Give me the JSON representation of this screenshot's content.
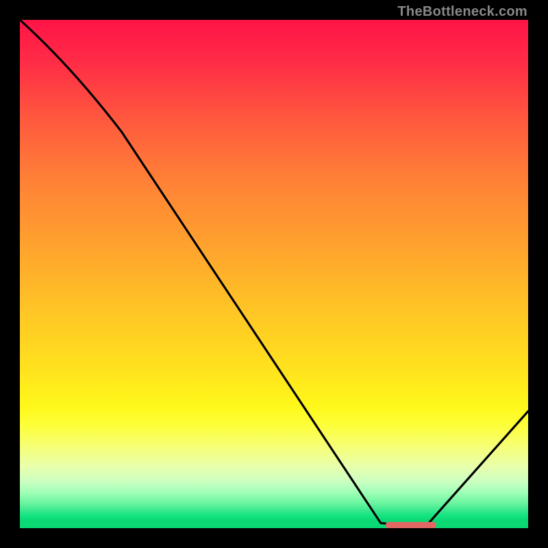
{
  "watermark": "TheBottleneck.com",
  "chart_data": {
    "type": "line",
    "title": "",
    "xlabel": "",
    "ylabel": "",
    "xlim": [
      0,
      100
    ],
    "ylim": [
      0,
      100
    ],
    "x": [
      0,
      20,
      71,
      80,
      100
    ],
    "values": [
      100,
      78,
      1,
      0.5,
      23
    ],
    "marker": {
      "x_start": 72,
      "x_end": 82,
      "y": 0.7
    },
    "background_gradient": {
      "direction": "vertical",
      "stops": [
        {
          "pos": 0.0,
          "color": "#ff1447"
        },
        {
          "pos": 0.5,
          "color": "#ffc226"
        },
        {
          "pos": 0.82,
          "color": "#fdff3c"
        },
        {
          "pos": 1.0,
          "color": "#0ad873"
        }
      ]
    }
  }
}
